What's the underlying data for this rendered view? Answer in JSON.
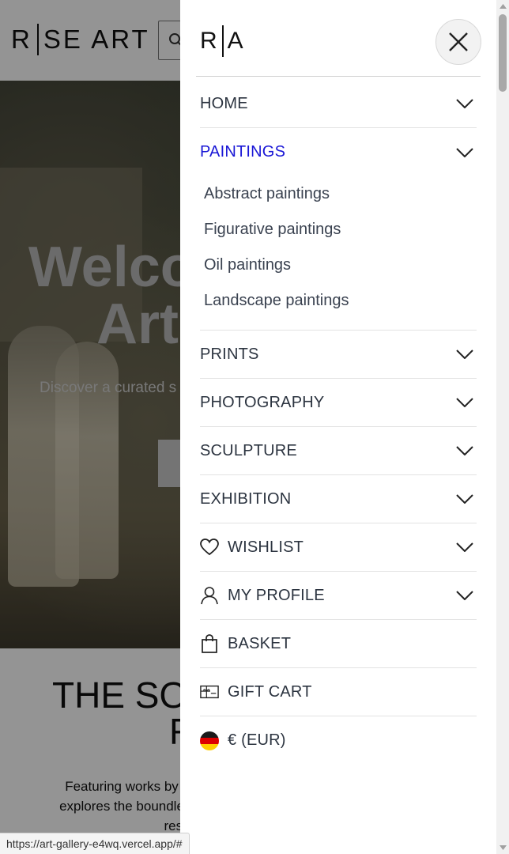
{
  "background": {
    "logo": {
      "left": "R",
      "right": "SE ART"
    },
    "hero": {
      "title_line1": "Welco",
      "title_line2": "Art",
      "subtitle": "Discover a curated s"
    },
    "section": {
      "title_line1": "THE SO",
      "title_line2": "R",
      "text_line1": "Featuring works by",
      "text_line2": "explores the boundle",
      "text_line3": "reso"
    }
  },
  "drawer": {
    "logo": {
      "left": "R",
      "right": "A"
    },
    "close_icon": "close-icon",
    "menu": [
      {
        "label": "HOME",
        "expandable": true
      },
      {
        "label": "PAINTINGS",
        "expandable": true,
        "active": true,
        "submenu": [
          "Abstract paintings",
          "Figurative paintings",
          "Oil paintings",
          "Landscape paintings"
        ]
      },
      {
        "label": "PRINTS",
        "expandable": true
      },
      {
        "label": "PHOTOGRAPHY",
        "expandable": true
      },
      {
        "label": "SCULPTURE",
        "expandable": true
      },
      {
        "label": "EXHIBITION",
        "expandable": true
      },
      {
        "label": "WISHLIST",
        "expandable": true,
        "icon": "heart-icon"
      },
      {
        "label": "MY PROFILE",
        "expandable": true,
        "icon": "user-icon"
      },
      {
        "label": "BASKET",
        "expandable": false,
        "icon": "shopping-bag-icon"
      },
      {
        "label": "GIFT CART",
        "expandable": false,
        "icon": "gift-card-icon"
      },
      {
        "label": "€ (EUR)",
        "expandable": false,
        "icon": "germany-flag-icon"
      }
    ]
  },
  "status_bar": {
    "url": "https://art-gallery-e4wq.vercel.app/#"
  },
  "colors": {
    "active": "#1a17d6",
    "text": "#2c3440",
    "overlay": "rgba(0,0,0,0.42)"
  }
}
